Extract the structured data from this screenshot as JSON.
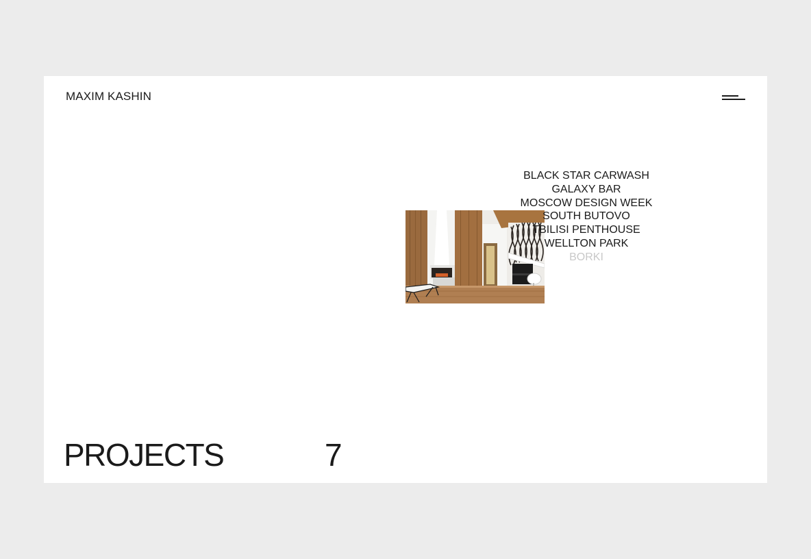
{
  "header": {
    "logo": "MAXIM KASHIN",
    "menu_icon": "menu-icon"
  },
  "projects": {
    "items": [
      {
        "label": "BLACK STAR CARWASH"
      },
      {
        "label": "GALAXY BAR"
      },
      {
        "label": "MOSCOW DESIGN WEEK"
      },
      {
        "label": "SOUTH BUTOVO"
      },
      {
        "label": "TBILISI PENTHOUSE"
      },
      {
        "label": "WELLTON PARK"
      },
      {
        "label": "BORKI"
      }
    ],
    "active_index": 6
  },
  "footer": {
    "title": "PROJECTS",
    "count": "7"
  },
  "colors": {
    "background": "#ececec",
    "panel": "#ffffff",
    "text": "#1a1a1a",
    "muted": "#c8c8c8",
    "wood": "#9a6a3e"
  }
}
